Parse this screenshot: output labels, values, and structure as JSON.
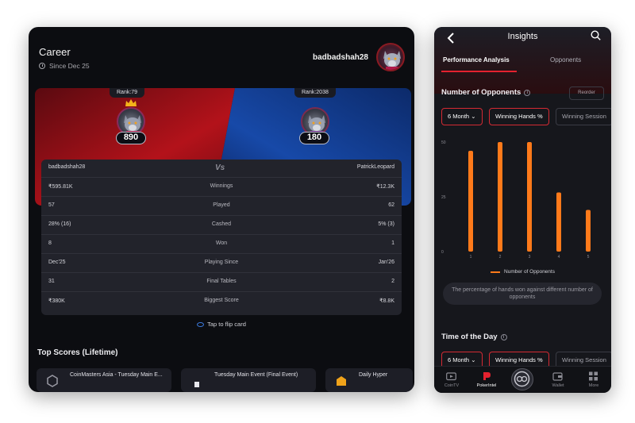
{
  "career": {
    "title": "Career",
    "since": "Since Dec 25",
    "username": "badbadshah28"
  },
  "versus": {
    "left": {
      "rank": "Rank:79",
      "score": "890",
      "name": "badbadshah28"
    },
    "right": {
      "rank": "Rank:2038",
      "score": "180",
      "name": "PatrickLeopard"
    },
    "vs_mark": "Vs",
    "colors": {
      "left": "#b3121a",
      "right": "#1749a8"
    },
    "stats": [
      {
        "left": "₹595.81K",
        "label": "Winnings",
        "right": "₹12.3K"
      },
      {
        "left": "57",
        "label": "Played",
        "right": "62"
      },
      {
        "left": "28% (16)",
        "label": "Cashed",
        "right": "5% (3)"
      },
      {
        "left": "8",
        "label": "Won",
        "right": "1"
      },
      {
        "left": "Dec'25",
        "label": "Playing Since",
        "right": "Jan'26"
      },
      {
        "left": "31",
        "label": "Final Tables",
        "right": "2"
      },
      {
        "left": "₹380K",
        "label": "Biggest Score",
        "right": "₹8.8K"
      }
    ],
    "flip_text": "Tap to flip card"
  },
  "top_scores": {
    "title": "Top Scores (Lifetime)",
    "cards": [
      {
        "title": "CoinMasters Asia - Tuesday Main E..."
      },
      {
        "title": "Tuesday Main Event (Final Event)"
      },
      {
        "title": "Daily Hyper"
      }
    ]
  },
  "insights": {
    "title": "Insights",
    "tabs": [
      "Performance Analysis",
      "Opponents"
    ],
    "opponents_section": {
      "title": "Number of Opponents",
      "reorder_label": "Reorder",
      "filters": [
        "6 Month",
        "Winning Hands %",
        "Winning Session"
      ]
    },
    "time_section": {
      "title": "Time of the Day",
      "filters": [
        "6 Month",
        "Winning Hands %",
        "Winning Session"
      ]
    },
    "note": "The percentage of hands won against different number of opponents",
    "accent": "#e4222f",
    "bar_color": "#ff7a1a"
  },
  "chart_data": {
    "type": "bar",
    "categories": [
      "1",
      "2",
      "3",
      "4",
      "5"
    ],
    "series": [
      {
        "name": "Number of Opponents",
        "values": [
          46,
          50,
          50,
          27,
          19
        ]
      }
    ],
    "yticks": [
      "50",
      "25",
      "0"
    ],
    "ylim": [
      0,
      50
    ],
    "xlabel": "",
    "ylabel": "",
    "grid": false,
    "legend": "bottom"
  },
  "nav": {
    "items": [
      {
        "label": "CoinTV",
        "icon": "tv-icon"
      },
      {
        "label": "PokerIntel",
        "icon": "pokerintel-icon"
      },
      {
        "label": "",
        "icon": "center-logo-icon"
      },
      {
        "label": "Wallet",
        "icon": "wallet-icon"
      },
      {
        "label": "More",
        "icon": "grid-icon"
      }
    ]
  }
}
